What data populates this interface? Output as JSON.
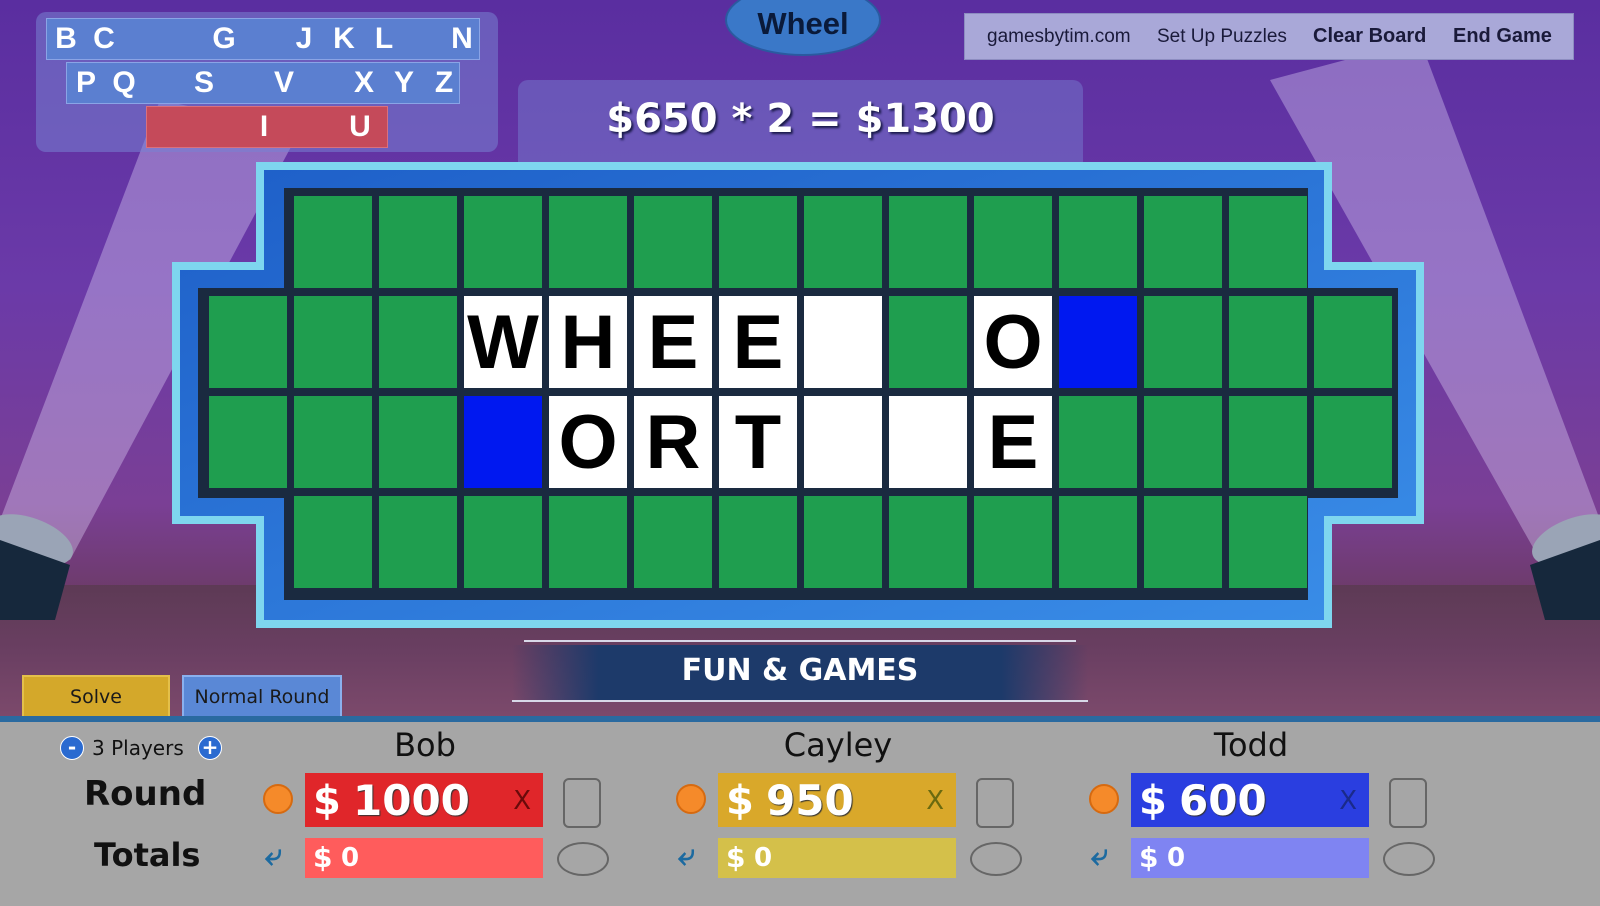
{
  "header": {
    "tab_title": "Wheel",
    "nav": {
      "site": "gamesbytim.com",
      "setup": "Set Up Puzzles",
      "clear": "Clear Board",
      "end": "End Game"
    }
  },
  "letters": {
    "row1": [
      "B",
      "C",
      "G",
      "J",
      "K",
      "L",
      "N"
    ],
    "row2": [
      "P",
      "Q",
      "S",
      "V",
      "X",
      "Y",
      "Z"
    ],
    "used": [
      "I",
      "U"
    ]
  },
  "spin_display": "$650 * 2 = $1300",
  "puzzle": {
    "row2": [
      "W",
      "H",
      "E",
      "E",
      "",
      "",
      "O",
      ""
    ],
    "row3": [
      "",
      "O",
      "R",
      "T",
      "",
      "",
      "E"
    ]
  },
  "category": "FUN & GAMES",
  "controls": {
    "solve": "Solve",
    "round_type": "Normal Round",
    "players_label": "3 Players",
    "minus": "-",
    "plus": "+"
  },
  "labels": {
    "round": "Round",
    "totals": "Totals"
  },
  "players": [
    {
      "name": "Bob",
      "round_dollar": "$",
      "round_score": "1000",
      "x": "X",
      "total_dollar": "$",
      "total": "0",
      "color": "#e0262a",
      "total_color": "#ff5c5c"
    },
    {
      "name": "Cayley",
      "round_dollar": "$",
      "round_score": "950",
      "x": "X",
      "total_dollar": "$",
      "total": "0",
      "color": "#d9a82a",
      "total_color": "#d4c04a"
    },
    {
      "name": "Todd",
      "round_dollar": "$",
      "round_score": "600",
      "x": "X",
      "total_dollar": "$",
      "total": "0",
      "color": "#2a3ee0",
      "total_color": "#7f84f2"
    }
  ]
}
